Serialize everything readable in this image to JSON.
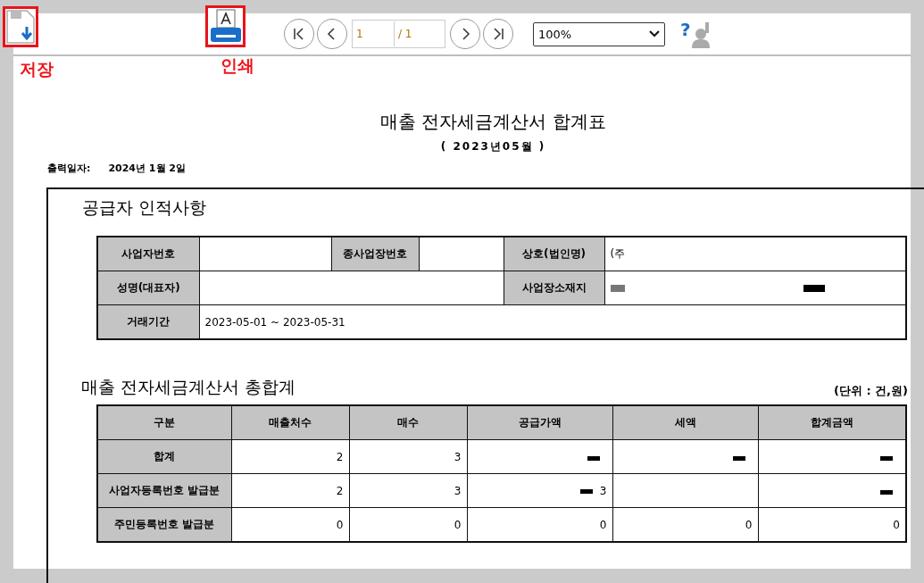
{
  "toolbar": {
    "save_label": "저장",
    "print_label": "인쇄",
    "page_input": "1",
    "page_total": "/ 1",
    "zoom": "100%",
    "help_glyph": "?"
  },
  "report": {
    "title": "매출 전자세금계산서 합계표",
    "period": "( 2023년05월 )",
    "print_date_label": "출력일자:",
    "print_date": "2024년 1월 2일",
    "supplier_heading": "공급자 인적사항",
    "supplier": {
      "biz_no_label": "사업자번호",
      "sub_biz_label": "종사업장번호",
      "company_label": "상호(법인명)",
      "company": "(주",
      "rep_label": "성명(대표자)",
      "address_label": "사업장소재지",
      "period_label": "거래기간",
      "period": "2023-05-01 ~ 2023-05-31"
    },
    "summary_heading": "매출 전자세금계산서 총합계",
    "unit": "(단위 : 건,원)",
    "columns": [
      "구분",
      "매출처수",
      "매수",
      "공급가액",
      "세액",
      "합계금액"
    ],
    "rows": [
      {
        "cells": [
          "합계",
          "2",
          "3",
          "",
          "",
          ""
        ],
        "redacted": [
          false,
          false,
          false,
          true,
          true,
          true
        ]
      },
      {
        "cells": [
          "사업자등록번호 발급분",
          "2",
          "3",
          "3",
          "",
          ""
        ],
        "redacted": [
          false,
          false,
          false,
          true,
          false,
          true
        ]
      },
      {
        "cells": [
          "주민등록번호 발급분",
          "0",
          "0",
          "0",
          "0",
          "0"
        ],
        "redacted": [
          false,
          false,
          false,
          false,
          false,
          false
        ]
      }
    ]
  }
}
